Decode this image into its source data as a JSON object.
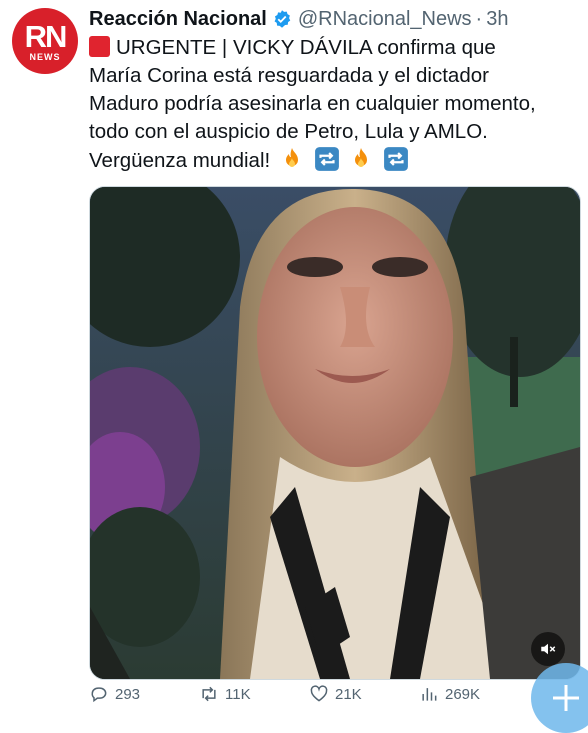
{
  "account": {
    "avatar_letters": "RN",
    "avatar_sub": "NEWS",
    "name": "Reacción Nacional",
    "handle": "@RNacional_News",
    "separator": "·",
    "time": "3h"
  },
  "tweet": {
    "line1": "URGENTE | VICKY DÁVILA confirma que",
    "line2": "María Corina está resguardada y el dictador",
    "line3": "Maduro podría asesinarla en cualquier momento,",
    "line4": "todo con el auspicio de Petro, Lula y AMLO.",
    "line5": "Vergüenza mundial!"
  },
  "actions": {
    "replies": "293",
    "retweets": "11K",
    "likes": "21K",
    "views": "269K"
  },
  "colors": {
    "brand_red": "#d8202a",
    "verified_blue": "#1d9bf0",
    "muted": "#536471"
  }
}
